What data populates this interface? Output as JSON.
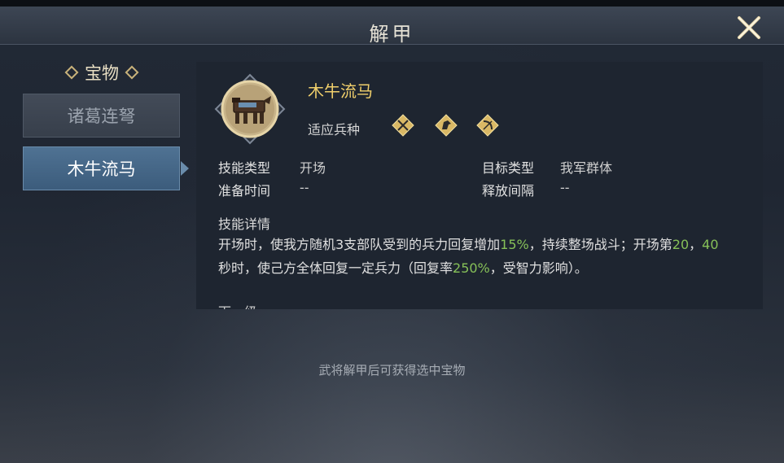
{
  "window": {
    "title": "解甲"
  },
  "sidebar": {
    "section_title": "宝物",
    "items": [
      {
        "label": "诸葛连弩",
        "selected": false
      },
      {
        "label": "木牛流马",
        "selected": true
      }
    ]
  },
  "detail": {
    "item_name": "木牛流马",
    "troop_label": "适应兵种",
    "troop_icons": [
      "crossed-spears-icon",
      "horse-head-icon",
      "bow-icon"
    ],
    "fields": {
      "skill_type": {
        "key": "技能类型",
        "value": "开场"
      },
      "target_type": {
        "key": "目标类型",
        "value": "我军群体"
      },
      "prep_time": {
        "key": "准备时间",
        "value": "--"
      },
      "release_interval": {
        "key": "释放间隔",
        "value": "--"
      }
    },
    "description_title": "技能详情",
    "description": {
      "p1": "开场时，使我方随机3支部队受到的兵力回复增加",
      "v1": "15%",
      "p2": "，持续整场战斗；开场第",
      "v2": "20",
      "p3": "，",
      "v3": "40",
      "p4": "秒时，使己方全体回复一定兵力（回复率",
      "v4": "250%",
      "p5": "，受智力影响）。"
    },
    "cut_text": "下一级"
  },
  "footer_text": "武将解甲后可获得选中宝物",
  "colors": {
    "highlight": "#86c058",
    "item_name": "#f0cf6b",
    "selected_tab": "#4f7293"
  }
}
